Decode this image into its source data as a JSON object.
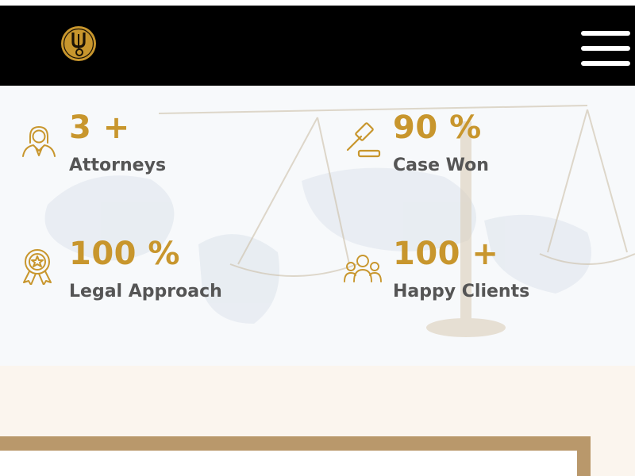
{
  "colors": {
    "accent": "#c8962d",
    "header_bg": "#000000",
    "label": "#555555",
    "frame": "#b9986b",
    "section_bg": "#fbf5ee"
  },
  "header": {
    "logo_icon": "law-firm-logo-icon",
    "menu_icon": "hamburger-menu-icon"
  },
  "stats": [
    {
      "icon": "attorney-icon",
      "value": "3 +",
      "label": "Attorneys"
    },
    {
      "icon": "gavel-icon",
      "value": "90 %",
      "label": "Case Won"
    },
    {
      "icon": "award-badge-icon",
      "value": "100 %",
      "label": "Legal Approach"
    },
    {
      "icon": "clients-group-icon",
      "value": "100 +",
      "label": "Happy Clients"
    }
  ]
}
